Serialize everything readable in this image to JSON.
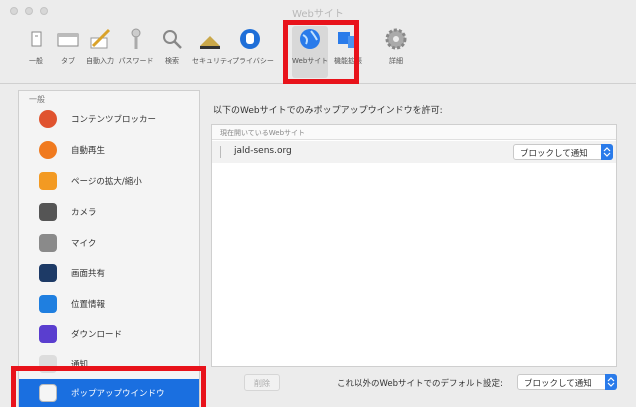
{
  "window": {
    "title": "Webサイト"
  },
  "toolbar": {
    "items": [
      {
        "label": "一般",
        "icon": "general-icon"
      },
      {
        "label": "タブ",
        "icon": "tabs-icon"
      },
      {
        "label": "自動入力",
        "icon": "autofill-icon"
      },
      {
        "label": "パスワード",
        "icon": "key-icon"
      },
      {
        "label": "検索",
        "icon": "search-icon"
      },
      {
        "label": "セキュリティ",
        "icon": "security-icon"
      },
      {
        "label": "プライバシー",
        "icon": "privacy-hand-icon"
      },
      {
        "label": "Webサイト",
        "icon": "globe-icon"
      },
      {
        "label": "機能拡張",
        "icon": "extensions-icon"
      },
      {
        "label": "詳細",
        "icon": "gear-icon"
      }
    ],
    "active": "Webサイト"
  },
  "sidebar": {
    "header": "一般",
    "items": [
      {
        "label": "コンテンツブロッカー",
        "icon": "content-blocker-icon"
      },
      {
        "label": "自動再生",
        "icon": "autoplay-icon"
      },
      {
        "label": "ページの拡大/縮小",
        "icon": "zoom-icon"
      },
      {
        "label": "カメラ",
        "icon": "camera-icon"
      },
      {
        "label": "マイク",
        "icon": "microphone-icon"
      },
      {
        "label": "画面共有",
        "icon": "screen-sharing-icon"
      },
      {
        "label": "位置情報",
        "icon": "location-icon"
      },
      {
        "label": "ダウンロード",
        "icon": "download-icon"
      },
      {
        "label": "通知",
        "icon": "notifications-icon"
      },
      {
        "label": "ポップアップウインドウ",
        "icon": "popup-window-icon"
      }
    ],
    "selected": "ポップアップウインドウ"
  },
  "main": {
    "heading": "以下のWebサイトでのみポップアップウインドウを許可:",
    "table_header": "現在開いているWebサイト",
    "rows": [
      {
        "site": "jald-sens.org",
        "setting": "ブロックして通知"
      }
    ],
    "remove_button": "削除",
    "default_label": "これ以外のWebサイトでのデフォルト設定:",
    "default_value": "ブロックして通知"
  },
  "colors": {
    "selection_blue": "#1a6fe0",
    "popup_arrow_blue": "#2a7bea",
    "highlight_red": "#e8131b"
  }
}
